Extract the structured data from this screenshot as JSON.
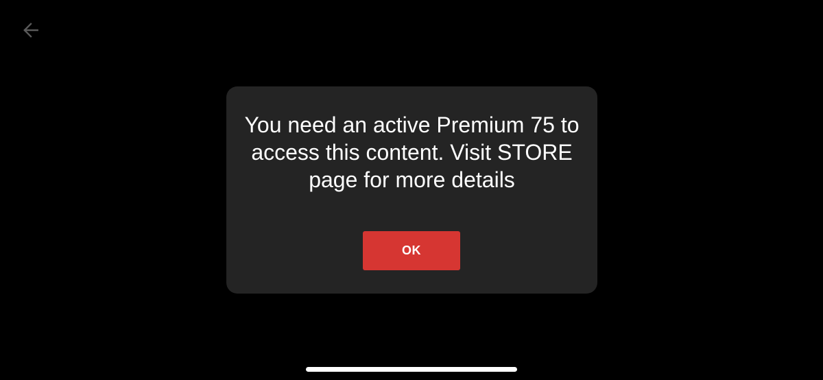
{
  "header": {
    "back_icon": "arrow-left-icon",
    "back_icon_color": "#5a5a5a"
  },
  "dialog": {
    "message": "You need an active Premium 75 to access this content. Visit STORE page for more details",
    "ok_label": "OK",
    "background_color": "#242424",
    "button_color": "#d63632"
  }
}
